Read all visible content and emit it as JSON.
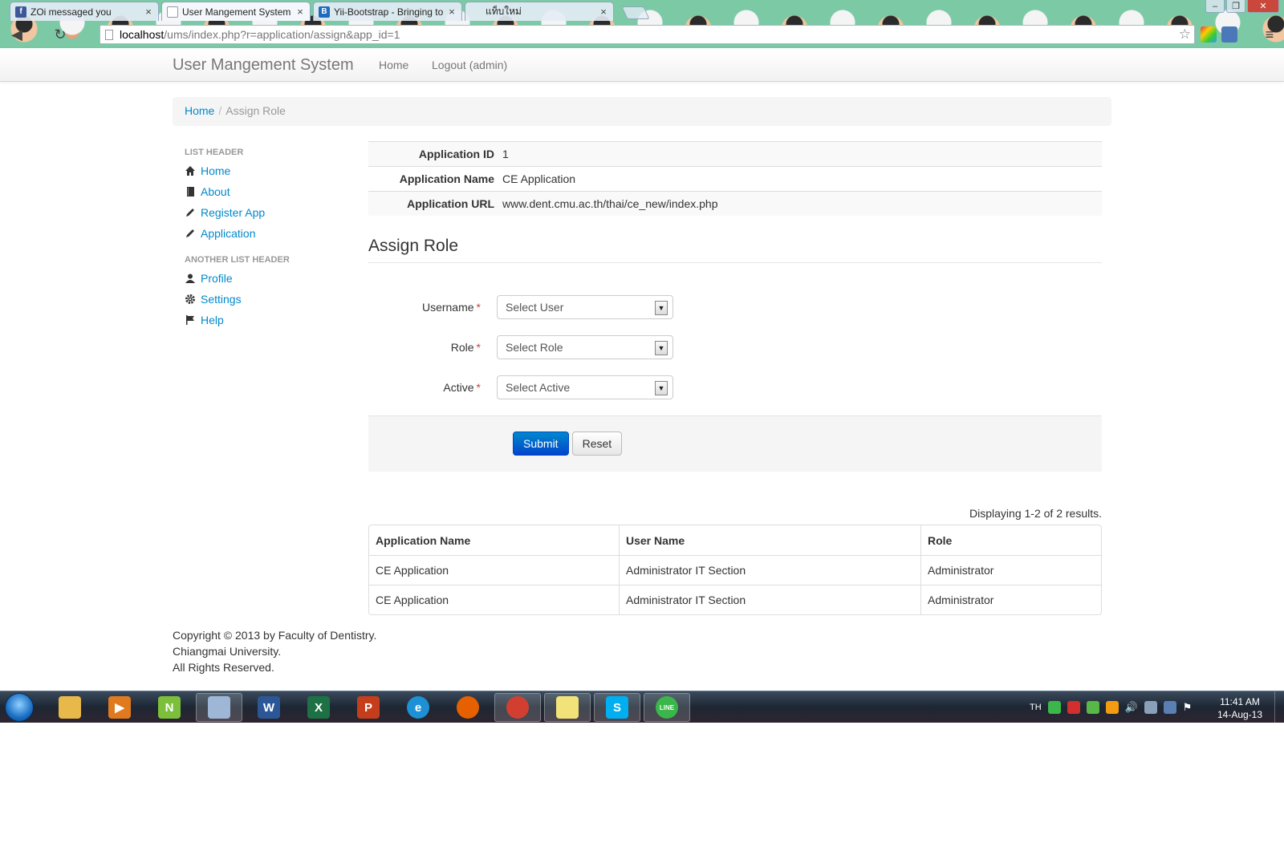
{
  "browser": {
    "tabs": [
      {
        "title": "ZOi messaged you",
        "favicon": "facebook-icon",
        "favicon_text": "f",
        "favicon_color": "#3b5998",
        "close": "×"
      },
      {
        "title": "User Mangement System",
        "favicon": "page-icon",
        "favicon_text": "",
        "favicon_color": "#ffffff",
        "close": "×"
      },
      {
        "title": "Yii-Bootstrap - Bringing to",
        "favicon": "bootstrap-icon",
        "favicon_text": "B",
        "favicon_color": "#1e6bbd",
        "close": "×"
      },
      {
        "title": "แท็บใหม่",
        "favicon": "blank-icon",
        "favicon_text": "",
        "favicon_color": "#ffffff",
        "close": "×"
      }
    ],
    "url_host": "localhost",
    "url_path": "/ums/index.php?r=application/assign&app_id=1"
  },
  "navbar": {
    "brand": "User Mangement System",
    "links": [
      "Home",
      "Logout (admin)"
    ]
  },
  "breadcrumb": {
    "home": "Home",
    "separator": "/",
    "current": "Assign Role"
  },
  "sidebar": {
    "header1": "LIST HEADER",
    "group1": [
      {
        "label": "Home",
        "icon": "home-icon"
      },
      {
        "label": "About",
        "icon": "book-icon"
      },
      {
        "label": "Register App",
        "icon": "pencil-icon"
      },
      {
        "label": "Application",
        "icon": "pencil-icon"
      }
    ],
    "header2": "ANOTHER LIST HEADER",
    "group2": [
      {
        "label": "Profile",
        "icon": "user-icon"
      },
      {
        "label": "Settings",
        "icon": "cog-icon"
      },
      {
        "label": "Help",
        "icon": "flag-icon"
      }
    ]
  },
  "detail": {
    "rows": [
      {
        "label": "Application ID",
        "value": "1"
      },
      {
        "label": "Application Name",
        "value": "CE Application"
      },
      {
        "label": "Application URL",
        "value": "www.dent.cmu.ac.th/thai/ce_new/index.php"
      }
    ]
  },
  "form": {
    "legend": "Assign Role",
    "required_mark": "*",
    "fields": [
      {
        "label": "Username",
        "value": "Select User"
      },
      {
        "label": "Role",
        "value": "Select Role"
      },
      {
        "label": "Active",
        "value": "Select Active"
      }
    ],
    "submit": "Submit",
    "reset": "Reset"
  },
  "grid": {
    "summary": "Displaying 1-2 of 2 results.",
    "columns": [
      "Application Name",
      "User Name",
      "Role"
    ],
    "rows": [
      [
        "CE Application",
        "Administrator IT Section",
        "Administrator"
      ],
      [
        "CE Application",
        "Administrator IT Section",
        "Administrator"
      ]
    ]
  },
  "footer": {
    "line1": "Copyright © 2013 by Faculty of Dentistry.",
    "line2": "Chiangmai University.",
    "line3": "All Rights Reserved."
  },
  "taskbar": {
    "apps": [
      {
        "name": "explorer",
        "icon": "folder-icon",
        "glyph": "",
        "color": "#e8b84a",
        "open": false
      },
      {
        "name": "media-player",
        "icon": "media-player-icon",
        "glyph": "▶",
        "color": "#e07a1f",
        "open": false
      },
      {
        "name": "notepad-plus",
        "icon": "notepad-icon",
        "glyph": "N",
        "color": "#7bbf3a",
        "open": false
      },
      {
        "name": "virtualbox",
        "icon": "cube-icon",
        "glyph": "",
        "color": "#9fb7d6",
        "open": true
      },
      {
        "name": "word",
        "icon": "word-icon",
        "glyph": "W",
        "color": "#2b5797",
        "open": false
      },
      {
        "name": "excel",
        "icon": "excel-icon",
        "glyph": "X",
        "color": "#1e7145",
        "open": false
      },
      {
        "name": "powerpoint",
        "icon": "powerpoint-icon",
        "glyph": "P",
        "color": "#c43e1c",
        "open": false
      },
      {
        "name": "internet-explorer",
        "icon": "ie-icon",
        "glyph": "e",
        "color": "#1e90d6",
        "open": false
      },
      {
        "name": "firefox",
        "icon": "firefox-icon",
        "glyph": "",
        "color": "#e66000",
        "open": false
      },
      {
        "name": "chrome",
        "icon": "chrome-icon",
        "glyph": "",
        "color": "#d23f31",
        "open": true
      },
      {
        "name": "sticky-notes",
        "icon": "sticky-notes-icon",
        "glyph": "",
        "color": "#f2e27a",
        "open": true
      },
      {
        "name": "skype",
        "icon": "skype-icon",
        "glyph": "S",
        "color": "#00aff0",
        "open": true
      },
      {
        "name": "line",
        "icon": "line-icon",
        "glyph": "LINE",
        "color": "#3bb64a",
        "open": true
      }
    ],
    "language": "TH",
    "time": "11:41 AM",
    "date": "14-Aug-13"
  }
}
